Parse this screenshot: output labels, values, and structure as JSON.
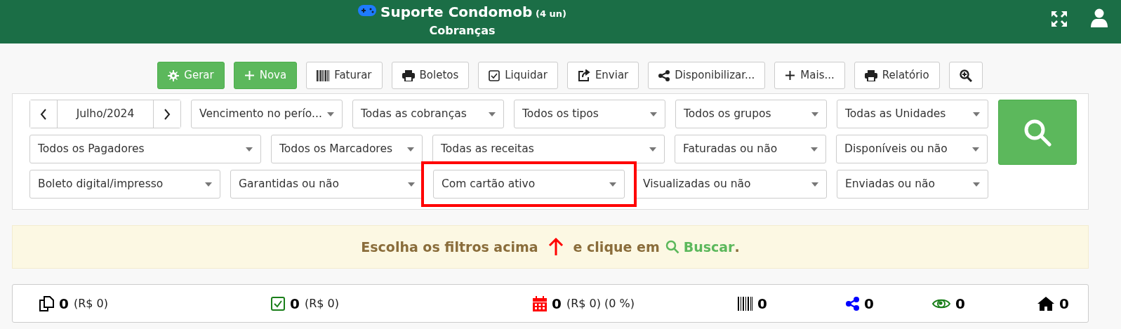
{
  "header": {
    "title": "Suporte Condomob",
    "units": "(4 un)",
    "subtitle": "Cobranças"
  },
  "toolbar": [
    {
      "label": "Gerar"
    },
    {
      "label": "Nova"
    },
    {
      "label": "Faturar"
    },
    {
      "label": "Boletos"
    },
    {
      "label": "Liquidar"
    },
    {
      "label": "Enviar"
    },
    {
      "label": "Disponibilizar..."
    },
    {
      "label": "Mais..."
    },
    {
      "label": "Relatório"
    }
  ],
  "filters": {
    "month": "Julho/2024",
    "rows": [
      [
        {
          "value": "Vencimento no perío...",
          "highlighted": false
        },
        {
          "value": "Todas as cobranças",
          "highlighted": false
        },
        {
          "value": "Todos os tipos",
          "highlighted": false
        },
        {
          "value": "Todos os grupos",
          "highlighted": false
        },
        {
          "value": "Todas as Unidades",
          "highlighted": false
        }
      ],
      [
        {
          "value": "Todos os Pagadores",
          "highlighted": false
        },
        {
          "value": "Todos os Marcadores",
          "highlighted": false
        },
        {
          "value": "Todas as receitas",
          "highlighted": false
        },
        {
          "value": "Faturadas ou não",
          "highlighted": false
        },
        {
          "value": "Disponíveis ou não",
          "highlighted": false
        }
      ],
      [
        {
          "value": "Boleto digital/impresso",
          "highlighted": false
        },
        {
          "value": "Garantidas ou não",
          "highlighted": false
        },
        {
          "value": "Com cartão ativo",
          "highlighted": true
        },
        {
          "value": "Visualizadas ou não",
          "highlighted": false
        },
        {
          "value": "Enviadas ou não",
          "highlighted": false
        }
      ]
    ]
  },
  "notice": {
    "before": "Escolha os filtros acima",
    "middle": "e clique em",
    "link": "Buscar",
    "after": "."
  },
  "stats": [
    {
      "count": "0",
      "detail": "(R$ 0)"
    },
    {
      "count": "0",
      "detail": "(R$ 0)"
    },
    {
      "count": "0",
      "detail": "(R$ 0) (0 %)"
    },
    {
      "count": "0"
    },
    {
      "count": "0"
    },
    {
      "count": "0"
    },
    {
      "count": "0"
    }
  ]
}
